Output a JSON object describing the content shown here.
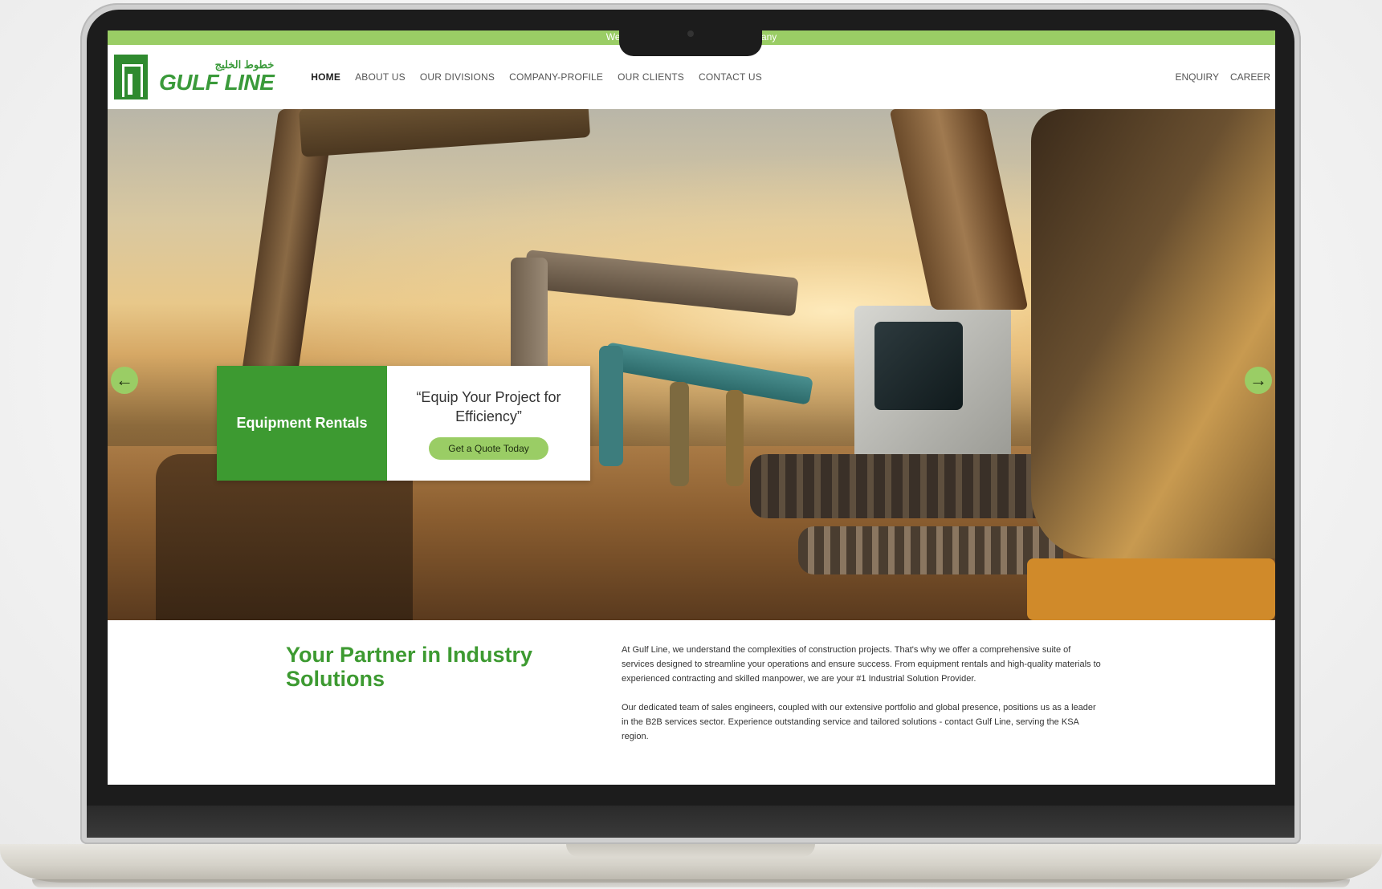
{
  "announcement": "Welcome to Gulf Line Trading Company",
  "logo": {
    "arabic": "خطوط الخليج",
    "name": "GULF LINE"
  },
  "nav": {
    "items": [
      "HOME",
      "ABOUT US",
      "OUR DIVISIONS",
      "COMPANY-PROFILE",
      "OUR CLIENTS",
      "CONTACT US"
    ],
    "right": [
      "ENQUIRY",
      "CAREER"
    ]
  },
  "hero": {
    "slide_title": "Equipment Rentals",
    "quote": "“Equip Your Project for Efficiency”",
    "cta": "Get a Quote Today",
    "prev_arrow": "arrow-left-icon",
    "next_arrow": "arrow-right-icon"
  },
  "about": {
    "title": "Your Partner in Industry Solutions",
    "paragraphs": [
      "At Gulf Line, we understand the complexities of construction projects. That's why we offer a comprehensive suite of services designed to streamline your operations and ensure success. From equipment rentals and high-quality materials to experienced contracting and skilled manpower, we are your #1 Industrial Solution Provider.",
      "Our dedicated team of sales engineers, coupled with our extensive portfolio and global presence, positions us as a leader in the B2B services sector. Experience outstanding service and tailored solutions - contact Gulf Line, serving the KSA region."
    ]
  },
  "colors": {
    "brand_green": "#3d9a31",
    "accent_lime": "#9acd65"
  }
}
